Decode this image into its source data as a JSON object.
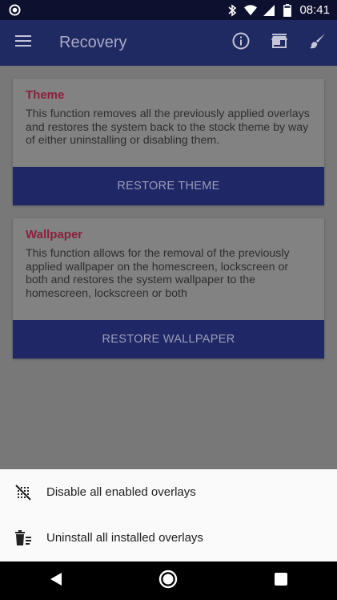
{
  "status_bar": {
    "time": "08:41",
    "battery_level": 0.8,
    "left_icon": "circle-notification-icon",
    "icons": [
      "bluetooth-icon",
      "wifi-icon",
      "cell-signal-icon",
      "battery-icon"
    ]
  },
  "toolbar": {
    "title": "Recovery",
    "nav_icon": "menu-icon",
    "actions": [
      "info-icon",
      "store-icon",
      "brush-icon"
    ]
  },
  "cards": {
    "theme": {
      "title": "Theme",
      "description": "This function removes all the previously applied overlays and restores the system back to the stock theme by way of either uninstalling or disabling them.",
      "button": "RESTORE THEME"
    },
    "wallpaper": {
      "title": "Wallpaper",
      "description": "This function allows for the removal of the previously applied wallpaper on the homescreen, lockscreen or both and restores the system wallpaper to the homescreen, lockscreen or both",
      "button": "RESTORE WALLPAPER"
    }
  },
  "sheet": {
    "items": [
      {
        "label": "Disable all enabled overlays",
        "icon": "disable-overlays-icon"
      },
      {
        "label": "Uninstall all installed overlays",
        "icon": "uninstall-trash-icon"
      }
    ]
  },
  "nav_bar": {
    "buttons": [
      "back-icon",
      "home-icon",
      "recents-icon"
    ]
  },
  "colors": {
    "status_bar": "#0e1030",
    "toolbar": "#202a62",
    "accent_title": "#8c1f3c",
    "button": "#1f2767",
    "sheet": "#fafafa"
  }
}
